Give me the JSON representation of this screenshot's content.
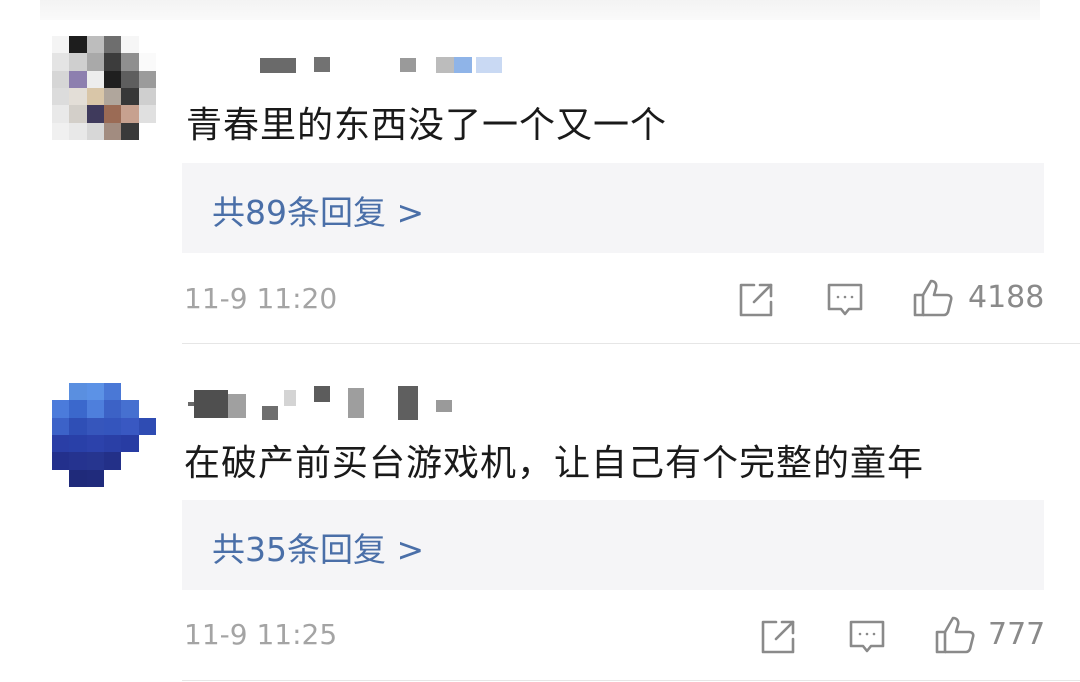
{
  "comments": [
    {
      "text": "青春里的东西没了一个又一个",
      "replies_label": "共89条回复 >",
      "timestamp": "11-9 11:20",
      "like_count": "4188"
    },
    {
      "text": "在破产前买台游戏机，让自己有个完整的童年",
      "replies_label": "共35条回复 >",
      "timestamp": "11-9 11:25",
      "like_count": "777"
    }
  ],
  "icons": {
    "share": "share-icon",
    "comment": "comment-icon",
    "like": "thumbs-up-icon"
  },
  "colors": {
    "reply_link": "#4a6fa8",
    "reply_box_bg": "#f5f5f7",
    "meta_text": "#a4a4a4",
    "comment_text": "#1a1a1a"
  }
}
